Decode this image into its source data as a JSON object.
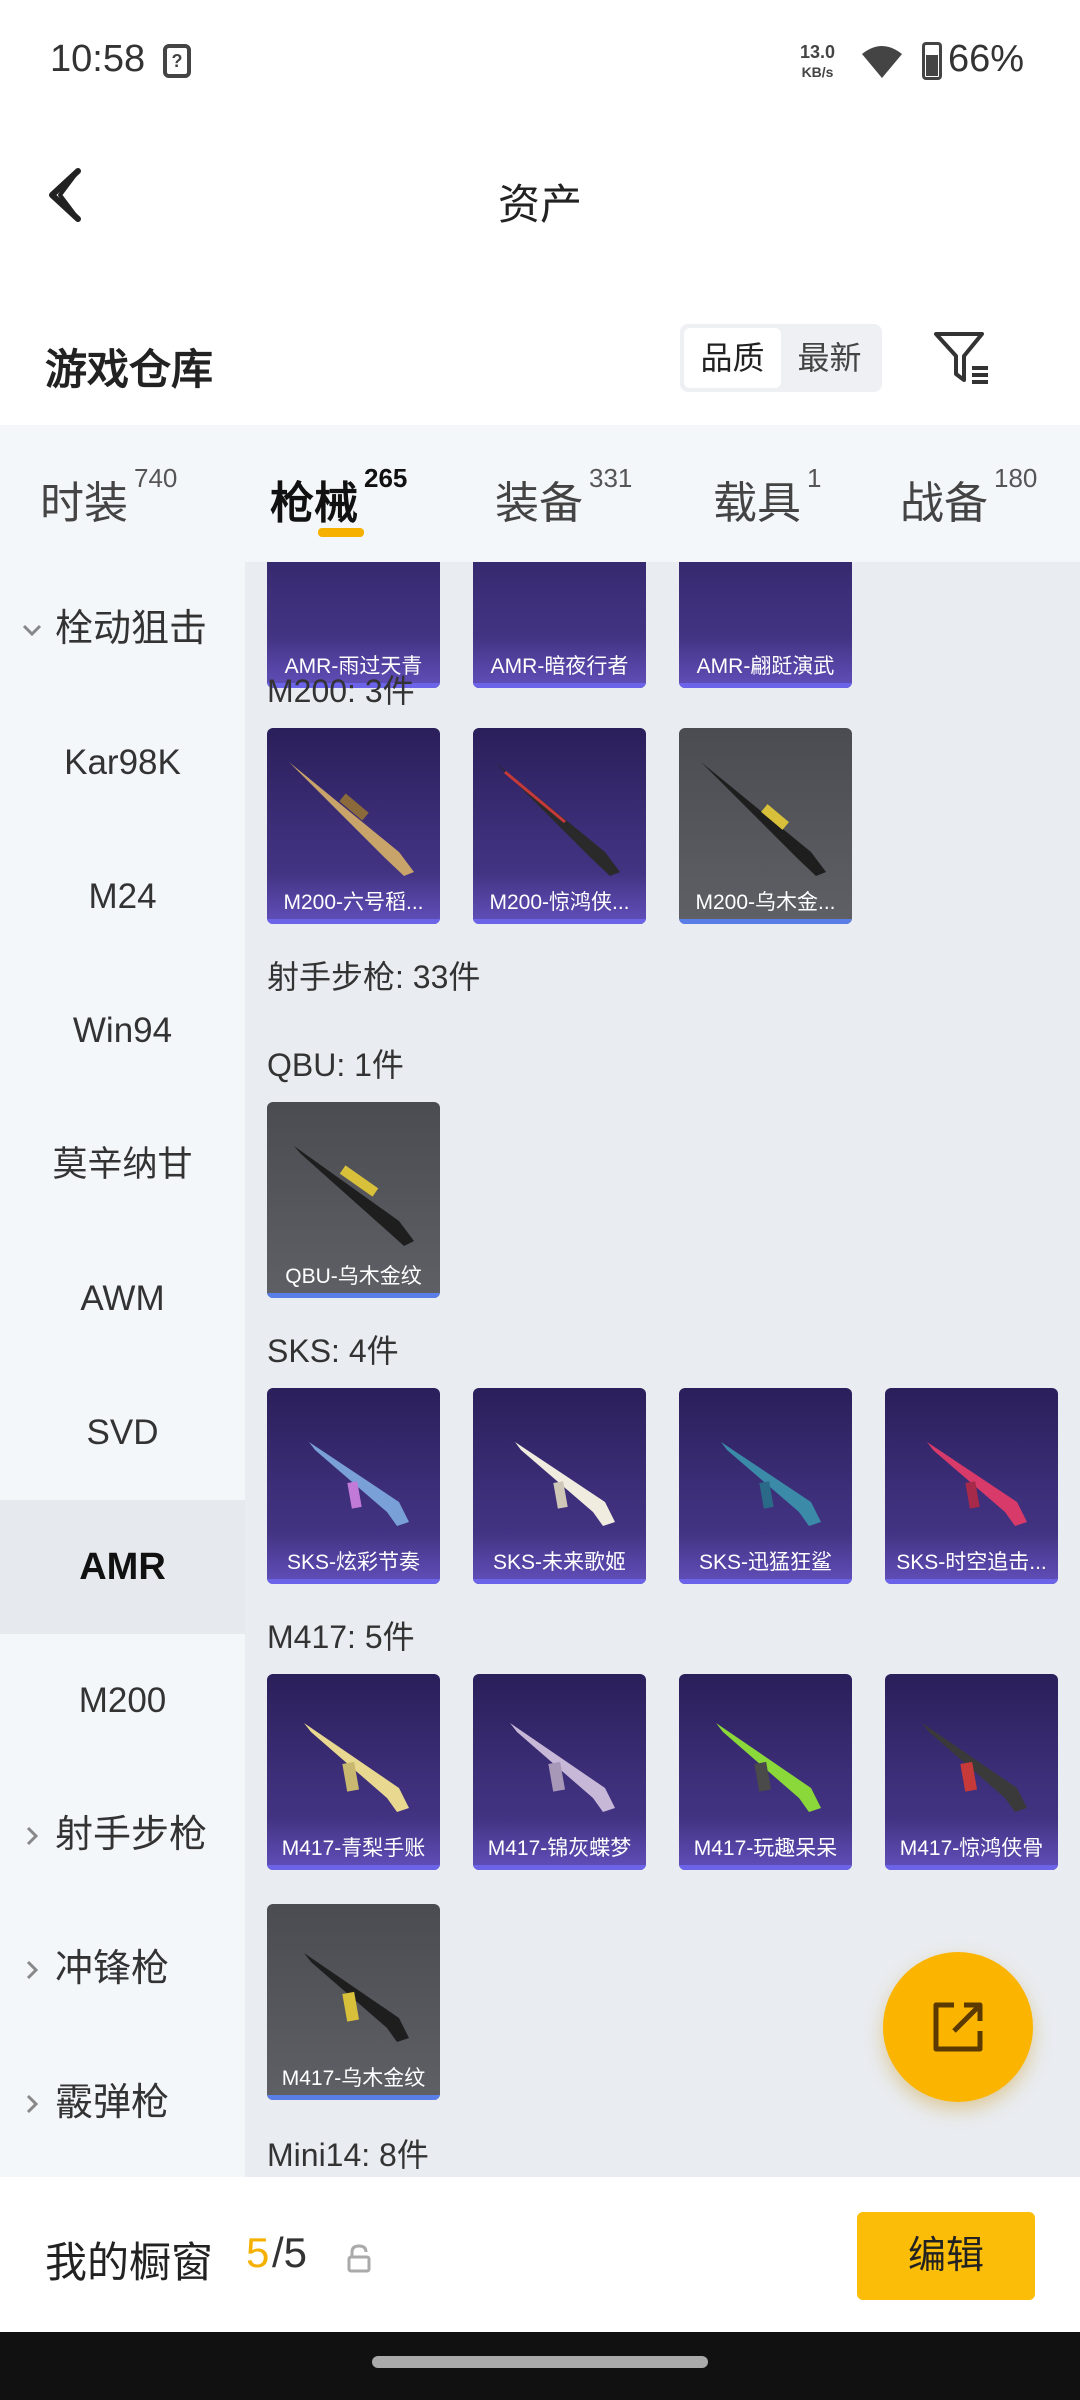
{
  "status": {
    "time": "10:58",
    "net_speed_value": "13.0",
    "net_speed_unit": "KB/s",
    "battery": "66%"
  },
  "header": {
    "title": "资产"
  },
  "warehouse": {
    "title": "游戏仓库",
    "sort_options": [
      "品质",
      "最新"
    ],
    "active_sort": "品质"
  },
  "tabs": [
    {
      "label": "时装",
      "count": "740"
    },
    {
      "label": "枪械",
      "count": "265",
      "active": true
    },
    {
      "label": "装备",
      "count": "331"
    },
    {
      "label": "载具",
      "count": "1"
    },
    {
      "label": "战备",
      "count": "180"
    }
  ],
  "sidebar": [
    {
      "label": "栓动狙击",
      "type": "group",
      "expanded": true
    },
    {
      "label": "Kar98K"
    },
    {
      "label": "M24"
    },
    {
      "label": "Win94"
    },
    {
      "label": "莫辛纳甘"
    },
    {
      "label": "AWM"
    },
    {
      "label": "SVD"
    },
    {
      "label": "AMR",
      "active": true
    },
    {
      "label": "M200"
    },
    {
      "label": "射手步枪",
      "type": "group"
    },
    {
      "label": "冲锋枪",
      "type": "group"
    },
    {
      "label": "霰弹枪",
      "type": "group"
    }
  ],
  "sections": {
    "amr_items": [
      "AMR-雨过天青",
      "AMR-暗夜行者",
      "AMR-翩跹演武"
    ],
    "m200": {
      "label": "M200: 3件",
      "items": [
        "M200-六号稻...",
        "M200-惊鸿侠...",
        "M200-乌木金..."
      ]
    },
    "marksman": {
      "label": "射手步枪: 33件"
    },
    "qbu": {
      "label": "QBU: 1件",
      "items": [
        "QBU-乌木金纹"
      ]
    },
    "sks": {
      "label": "SKS: 4件",
      "items": [
        "SKS-炫彩节奏",
        "SKS-未来歌姬",
        "SKS-迅猛狂鲨",
        "SKS-时空追击..."
      ]
    },
    "m417": {
      "label": "M417: 5件",
      "items": [
        "M417-青梨手账",
        "M417-锦灰蝶梦",
        "M417-玩趣呆呆",
        "M417-惊鸿侠骨",
        "M417-乌木金纹"
      ]
    },
    "mini14": {
      "label": "Mini14: 8件"
    }
  },
  "bottom": {
    "my_window": "我的橱窗",
    "count_current": "5",
    "count_total": "/5",
    "edit_label": "编辑"
  },
  "colors": {
    "accent": "#fbbd08",
    "purple_card": "#3d2f7a",
    "grey_card": "#56585e"
  }
}
